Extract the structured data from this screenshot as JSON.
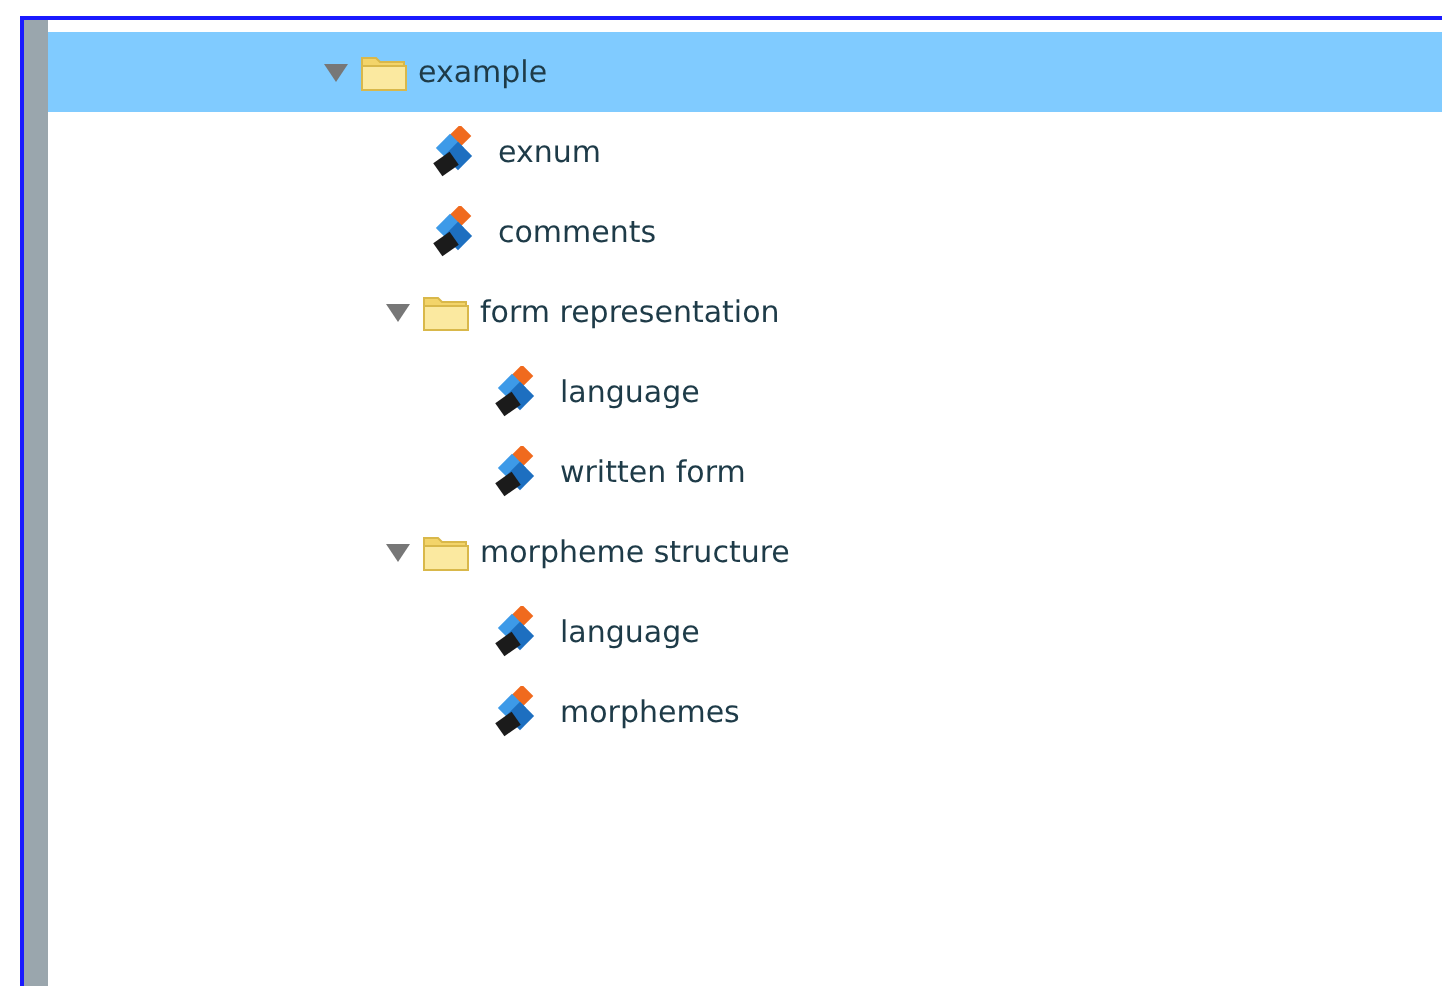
{
  "tree": [
    {
      "kind": "folder",
      "label": "example",
      "selected": true,
      "expanded": true,
      "children": [
        {
          "kind": "leaf",
          "label": "exnum",
          "selected": false
        },
        {
          "kind": "leaf",
          "label": "comments",
          "selected": false
        },
        {
          "kind": "folder",
          "label": "form representation",
          "selected": false,
          "expanded": true,
          "children": [
            {
              "kind": "leaf",
              "label": "language",
              "selected": false
            },
            {
              "kind": "leaf",
              "label": "written form",
              "selected": false
            }
          ]
        },
        {
          "kind": "folder",
          "label": "morpheme structure",
          "selected": false,
          "expanded": true,
          "children": [
            {
              "kind": "leaf",
              "label": "language",
              "selected": false
            },
            {
              "kind": "leaf",
              "label": "morphemes",
              "selected": false
            }
          ]
        }
      ]
    }
  ]
}
